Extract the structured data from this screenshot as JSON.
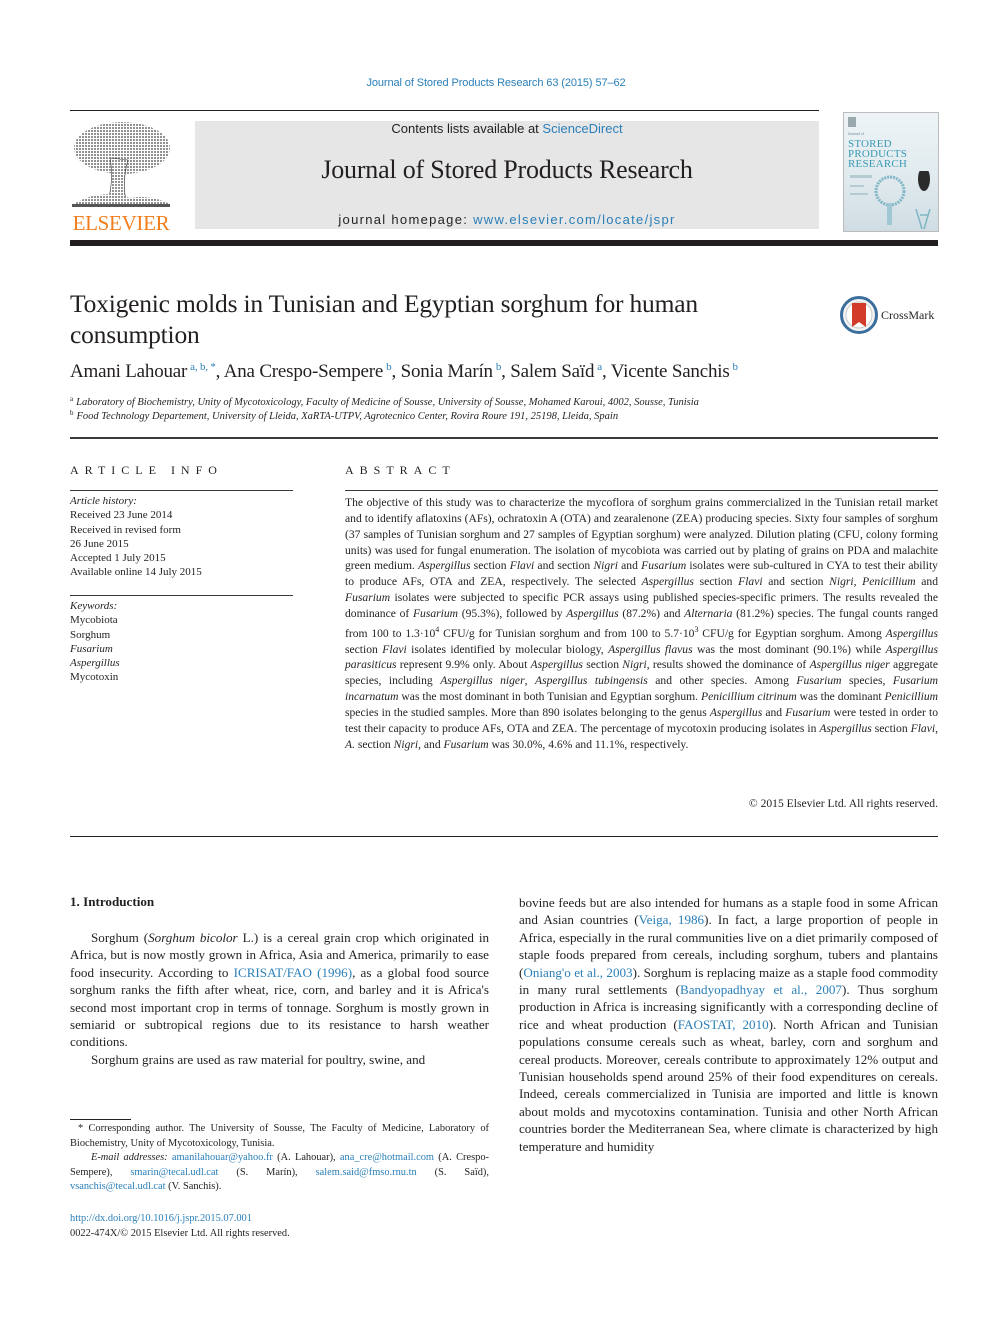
{
  "running_head": "Journal of Stored Products Research 63 (2015) 57–62",
  "masthead": {
    "publisher": "ELSEVIER",
    "contents_prefix": "Contents lists available at ",
    "contents_link": "ScienceDirect",
    "journal_title": "Journal of Stored Products Research",
    "homepage_prefix": "journal homepage: ",
    "homepage_link": "www.elsevier.com/locate/jspr",
    "cover_title_lines": [
      "STORED",
      "PRODUCTS",
      "RESEARCH"
    ],
    "cover_small": "Journal of"
  },
  "article": {
    "title": "Toxigenic molds in Tunisian and Egyptian sorghum for human consumption",
    "crossmark_label": "CrossMark",
    "authors": [
      {
        "name": "Amani Lahouar",
        "marks": "a, b, *"
      },
      {
        "name": "Ana Crespo-Sempere",
        "marks": "b"
      },
      {
        "name": "Sonia Marín",
        "marks": "b"
      },
      {
        "name": "Salem Saïd",
        "marks": "a"
      },
      {
        "name": "Vicente Sanchis",
        "marks": "b"
      }
    ],
    "affiliations": [
      {
        "mark": "a",
        "text": "Laboratory of Biochemistry, Unity of Mycotoxicology, Faculty of Medicine of Sousse, University of Sousse, Mohamed Karoui, 4002, Sousse, Tunisia"
      },
      {
        "mark": "b",
        "text": "Food Technology Departement, University of Lleida, XaRTA-UTPV, Agrotecnico Center, Rovira Roure 191, 25198, Lleida, Spain"
      }
    ]
  },
  "article_info": {
    "label": "ARTICLE INFO",
    "history_label": "Article history:",
    "history": [
      "Received 23 June 2014",
      "Received in revised form",
      "26 June 2015",
      "Accepted 1 July 2015",
      "Available online 14 July 2015"
    ],
    "keywords_label": "Keywords:",
    "keywords": [
      {
        "text": "Mycobiota",
        "italic": false
      },
      {
        "text": "Sorghum",
        "italic": false
      },
      {
        "text": "Fusarium",
        "italic": true
      },
      {
        "text": "Aspergillus",
        "italic": true
      },
      {
        "text": "Mycotoxin",
        "italic": false
      }
    ]
  },
  "abstract": {
    "label": "ABSTRACT",
    "text": "The objective of this study was to characterize the mycoflora of sorghum grains commercialized in the Tunisian retail market and to identify aflatoxins (AFs), ochratoxin A (OTA) and zearalenone (ZEA) producing species. Sixty four samples of sorghum (37 samples of Tunisian sorghum and 27 samples of Egyptian sorghum) were analyzed. Dilution plating (CFU, colony forming units) was used for fungal enumeration. The isolation of mycobiota was carried out by plating of grains on PDA and malachite green medium. Aspergillus section Flavi and section Nigri and Fusarium isolates were sub-cultured in CYA to test their ability to produce AFs, OTA and ZEA, respectively. The selected Aspergillus section Flavi and section Nigri, Penicillium and Fusarium isolates were subjected to specific PCR assays using published species-specific primers. The results revealed the dominance of Fusarium (95.3%), followed by Aspergillus (87.2%) and Alternaria (81.2%) species. The fungal counts ranged from 100 to 1.3·10^4 CFU/g for Tunisian sorghum and from 100 to 5.7·10^3 CFU/g for Egyptian sorghum. Among Aspergillus section Flavi isolates identified by molecular biology, Aspergillus flavus was the most dominant (90.1%) while Aspergillus parasiticus represent 9.9% only. About Aspergillus section Nigri, results showed the dominance of Aspergillus niger aggregate species, including Aspergillus niger, Aspergillus tubingensis and other species. Among Fusarium species, Fusarium incarnatum was the most dominant in both Tunisian and Egyptian sorghum. Penicillium citrinum was the dominant Penicillium species in the studied samples. More than 890 isolates belonging to the genus Aspergillus and Fusarium were tested in order to test their capacity to produce AFs, OTA and ZEA. The percentage of mycotoxin producing isolates in Aspergillus section Flavi, A. section Nigri, and Fusarium was 30.0%, 4.6% and 11.1%, respectively.",
    "italic_terms": [
      "Aspergillus",
      "Flavi",
      "Nigri",
      "Fusarium",
      "Penicillium",
      "Alternaria",
      "Aspergillus flavus",
      "Aspergillus parasiticus",
      "Aspergillus niger",
      "Aspergillus tubingensis",
      "Fusarium incarnatum",
      "Penicillium citrinum",
      "A."
    ],
    "copyright": "© 2015 Elsevier Ltd. All rights reserved."
  },
  "introduction": {
    "heading": "1.  Introduction",
    "left_paragraphs": [
      "Sorghum (Sorghum bicolor L.) is a cereal grain crop which originated in Africa, but is now mostly grown in Africa, Asia and America, primarily to ease food insecurity. According to ICRISAT/FAO (1996), as a global food source sorghum ranks the fifth after wheat, rice, corn, and barley and it is Africa's second most important crop in terms of tonnage. Sorghum is mostly grown in semiarid or subtropical regions due to its resistance to harsh weather conditions.",
      "Sorghum grains are used as raw material for poultry, swine, and"
    ],
    "right_paragraph": "bovine feeds but are also intended for humans as a staple food in some African and Asian countries (Veiga, 1986). In fact, a large proportion of people in Africa, especially in the rural communities live on a diet primarily composed of staple foods prepared from cereals, including sorghum, tubers and plantains (Oniang'o et al., 2003). Sorghum is replacing maize as a staple food commodity in many rural settlements (Bandyopadhyay et al., 2007). Thus sorghum production in Africa is increasing significantly with a corresponding decline of rice and wheat production (FAOSTAT, 2010). North African and Tunisian populations consume cereals such as wheat, barley, corn and sorghum and cereal products. Moreover, cereals contribute to approximately 12% output and Tunisian households spend around 25% of their food expenditures on cereals. Indeed, cereals commercialized in Tunisia are imported and little is known about molds and mycotoxins contamination. Tunisia and other North African countries border the Mediterranean Sea, where climate is characterized by high temperature and humidity",
    "citations": [
      "ICRISAT/FAO (1996)",
      "Veiga, 1986",
      "Oniang'o et al., 2003",
      "Bandyopadhyay et al., 2007",
      "FAOSTAT, 2010"
    ]
  },
  "footnotes": {
    "corresponding": "* Corresponding author. The University of Sousse, The Faculty of Medicine, Laboratory of Biochemistry, Unity of Mycotoxicology, Tunisia.",
    "email_label": "E-mail addresses:",
    "emails": [
      {
        "email": "amanilahouar@yahoo.fr",
        "who": "(A. Lahouar)"
      },
      {
        "email": "ana_cre@hotmail.com",
        "who": "(A. Crespo-Sempere)"
      },
      {
        "email": "smarin@tecal.udl.cat",
        "who": "(S. Marín)"
      },
      {
        "email": "salem.said@fmso.rnu.tn",
        "who": "(S. Saïd)"
      },
      {
        "email": "vsanchis@tecal.udl.cat",
        "who": "(V. Sanchis)."
      }
    ],
    "doi": "http://dx.doi.org/10.1016/j.jspr.2015.07.001",
    "issn_line": "0022-474X/© 2015 Elsevier Ltd. All rights reserved."
  },
  "colors": {
    "link": "#2a7fb8",
    "elsevier_orange": "#f27e1d",
    "masthead_bg": "#e6e6e6",
    "text": "#231f20"
  }
}
